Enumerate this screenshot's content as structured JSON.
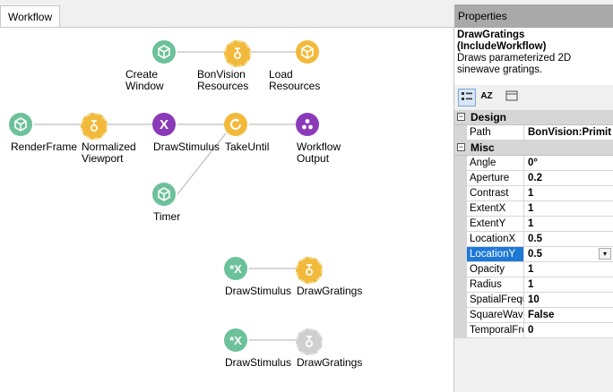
{
  "tabs": [
    {
      "label": "Workflow"
    }
  ],
  "nodes": [
    {
      "id": "create-window",
      "label": "Create\nWindow",
      "color": "green",
      "icon": "cube-icon"
    },
    {
      "id": "bonvision-resources",
      "label": "BonVision\nResources",
      "color": "amber",
      "icon": "workflow-icon"
    },
    {
      "id": "load-resources",
      "label": "Load\nResources",
      "color": "amber",
      "icon": "cube-icon"
    },
    {
      "id": "render-frame",
      "label": "RenderFrame",
      "color": "green",
      "icon": "cube-icon"
    },
    {
      "id": "normalized-viewport",
      "label": "Normalized\nViewport",
      "color": "amber",
      "icon": "workflow-icon"
    },
    {
      "id": "draw-stimulus",
      "label": "DrawStimulus",
      "color": "purple",
      "icon": "x-icon"
    },
    {
      "id": "take-until",
      "label": "TakeUntil",
      "color": "amber",
      "icon": "cycle-icon"
    },
    {
      "id": "workflow-output",
      "label": "Workflow\nOutput",
      "color": "purple",
      "icon": "dots-icon"
    },
    {
      "id": "timer",
      "label": "Timer",
      "color": "green",
      "icon": "cube-icon"
    },
    {
      "id": "draw-stimulus-2",
      "label": "DrawStimulus",
      "color": "green",
      "icon": "star-x-icon"
    },
    {
      "id": "draw-gratings",
      "label": "DrawGratings",
      "color": "amber",
      "icon": "workflow-icon"
    },
    {
      "id": "draw-stimulus-3",
      "label": "DrawStimulus",
      "color": "green",
      "icon": "star-x-icon"
    },
    {
      "id": "draw-gratings-2",
      "label": "DrawGratings",
      "color": "gray",
      "icon": "workflow-icon"
    }
  ],
  "colors": {
    "green": "#6cc19a",
    "amber": "#f2b93b",
    "purple": "#8a3ab8",
    "gray": "#cfcfcf",
    "selection": "#1e78d7"
  },
  "properties": {
    "title": "Properties",
    "selected_name": "DrawGratings\n(IncludeWorkflow)",
    "selected_description": "Draws parameterized 2D sinewave gratings.",
    "toolbar": {
      "categorized_icon": "categorized-icon",
      "alphabetical_label": "AZ",
      "pages_icon": "property-pages-icon"
    },
    "categories": [
      {
        "name": "Design",
        "rows": [
          {
            "name": "Path",
            "value": "BonVision:Primit"
          }
        ]
      },
      {
        "name": "Misc",
        "rows": [
          {
            "name": "Angle",
            "value": "0°"
          },
          {
            "name": "Aperture",
            "value": "0.2"
          },
          {
            "name": "Contrast",
            "value": "1"
          },
          {
            "name": "ExtentX",
            "value": "1"
          },
          {
            "name": "ExtentY",
            "value": "1"
          },
          {
            "name": "LocationX",
            "value": "0.5"
          },
          {
            "name": "LocationY",
            "value": "0.5"
          },
          {
            "name": "Opacity",
            "value": "1"
          },
          {
            "name": "Radius",
            "value": "1"
          },
          {
            "name": "SpatialFrequ",
            "value": "10"
          },
          {
            "name": "SquareWave",
            "value": "False"
          },
          {
            "name": "TemporalFre",
            "value": "0"
          }
        ]
      }
    ]
  }
}
